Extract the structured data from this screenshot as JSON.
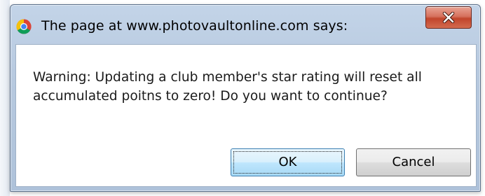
{
  "dialog": {
    "title": "The page at www.photovaultonline.com says:",
    "browser_icon": "chrome-icon",
    "close_icon": "close-icon",
    "message": "Warning:  Updating a club member's star rating will reset all\naccumulated poitns to zero! Do you want to continue?",
    "buttons": {
      "ok_label": "OK",
      "cancel_label": "Cancel"
    }
  },
  "colors": {
    "frame": "#b7c9df",
    "close_button": "#c1452c",
    "ok_highlight": "#bee6fd"
  }
}
